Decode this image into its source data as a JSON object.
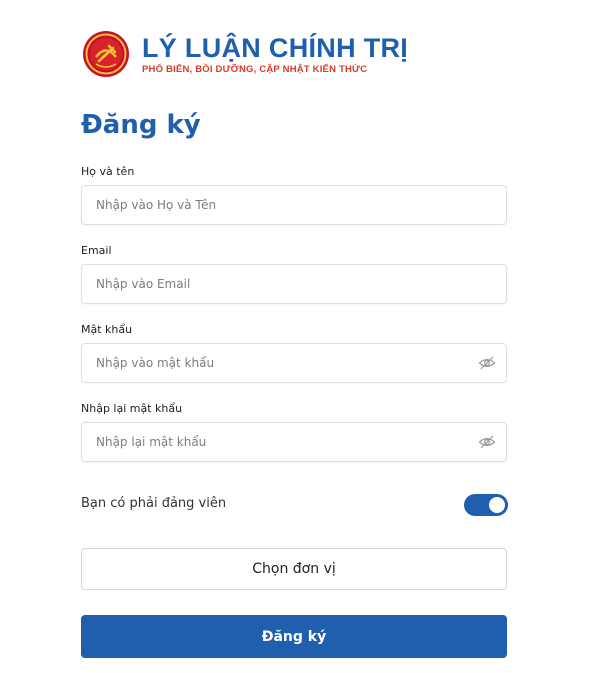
{
  "brand": {
    "title": "LÝ LUẬN CHÍNH TRỊ",
    "subtitle": "PHỔ BIẾN, BỒI DƯỠNG, CẬP NHẬT KIẾN THỨC",
    "colors": {
      "title": "#1f5fad",
      "subtitle": "#d83a2a",
      "emblem": "#c8102e"
    }
  },
  "form": {
    "title": "Đăng ký",
    "fields": [
      {
        "label": "Họ và tên",
        "placeholder": "Nhập vào Họ và Tên",
        "value": ""
      },
      {
        "label": "Email",
        "placeholder": "Nhập vào Email",
        "value": ""
      },
      {
        "label": "Mật khẩu",
        "placeholder": "Nhập vào mật khẩu",
        "value": "",
        "icon": "eye-off-icon"
      },
      {
        "label": "Nhập lại mật khẩu",
        "placeholder": "Nhập lại mật khẩu",
        "value": "",
        "icon": "eye-off-icon"
      }
    ],
    "party_member": {
      "label": "Bạn có phải đảng viên",
      "checked": true
    },
    "unit_button": "Chọn đơn vị",
    "submit_button": "Đăng ký"
  },
  "colors": {
    "accent": "#1f5fad",
    "border": "#dedede"
  }
}
